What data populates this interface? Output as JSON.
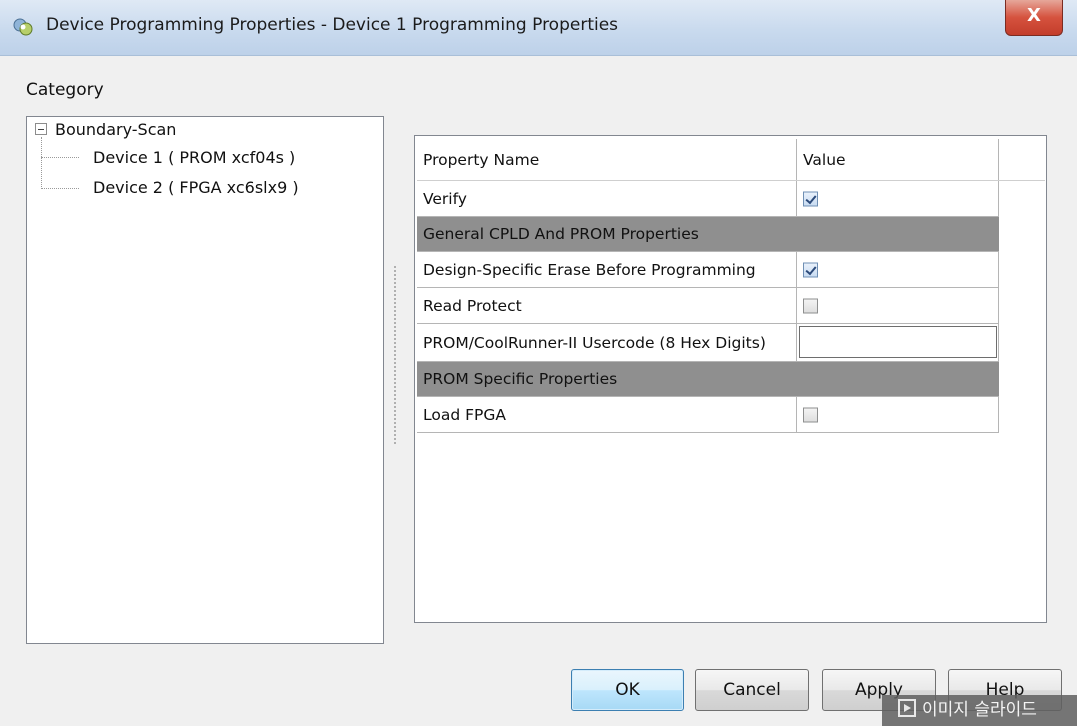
{
  "window": {
    "title": "Device Programming Properties - Device 1 Programming Properties",
    "icon": "device-programming-icon",
    "close_label": "X"
  },
  "category": {
    "label": "Category",
    "tree": {
      "root": "Boundary-Scan",
      "children": [
        "Device 1 ( PROM xcf04s )",
        "Device 2 ( FPGA xc6slx9 )"
      ]
    }
  },
  "properties": {
    "header": {
      "name": "Property Name",
      "value": "Value"
    },
    "rows": [
      {
        "name": "Verify",
        "type": "checkbox",
        "checked": true
      },
      {
        "name": "General CPLD And PROM Properties",
        "type": "category"
      },
      {
        "name": "Design-Specific Erase Before Programming",
        "type": "checkbox",
        "checked": true
      },
      {
        "name": "Read Protect",
        "type": "checkbox",
        "checked": false
      },
      {
        "name": "PROM/CoolRunner-II Usercode (8 Hex Digits)",
        "type": "text",
        "value": ""
      },
      {
        "name": "PROM Specific Properties",
        "type": "category"
      },
      {
        "name": "Load FPGA",
        "type": "checkbox",
        "checked": false
      }
    ]
  },
  "buttons": {
    "ok": "OK",
    "cancel": "Cancel",
    "apply": "Apply",
    "help": "Help"
  },
  "watermark": {
    "text": "이미지 슬라이드",
    "icon": "play-icon"
  },
  "colors": {
    "category_row": "#8f8f8f",
    "default_button": "#bee6fd",
    "close_button": "#c33d2b"
  }
}
